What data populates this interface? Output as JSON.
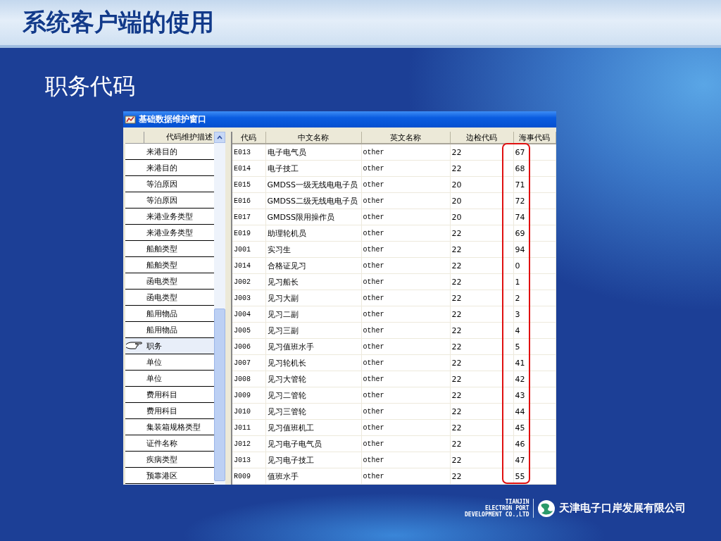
{
  "slide": {
    "title": "系统客户端的使用",
    "subtitle": "职务代码"
  },
  "window": {
    "title": "基础数据维护窗口"
  },
  "category_list": {
    "column_2": "代码维护描述",
    "items": [
      {
        "label": "来港目的",
        "selected": false
      },
      {
        "label": "来港目的",
        "selected": false
      },
      {
        "label": "等泊原因",
        "selected": false
      },
      {
        "label": "等泊原因",
        "selected": false
      },
      {
        "label": "来港业务类型",
        "selected": false
      },
      {
        "label": "来港业务类型",
        "selected": false
      },
      {
        "label": "船舶类型",
        "selected": false
      },
      {
        "label": "船舶类型",
        "selected": false
      },
      {
        "label": "函电类型",
        "selected": false
      },
      {
        "label": "函电类型",
        "selected": false
      },
      {
        "label": "船用物品",
        "selected": false
      },
      {
        "label": "船用物品",
        "selected": false
      },
      {
        "label": "职务",
        "selected": true
      },
      {
        "label": "单位",
        "selected": false
      },
      {
        "label": "单位",
        "selected": false
      },
      {
        "label": "费用科目",
        "selected": false
      },
      {
        "label": "费用科目",
        "selected": false
      },
      {
        "label": "集装箱规格类型",
        "selected": false
      },
      {
        "label": "证件名称",
        "selected": false
      },
      {
        "label": "疾病类型",
        "selected": false
      },
      {
        "label": "预靠港区",
        "selected": false
      }
    ]
  },
  "table": {
    "columns": [
      "代码",
      "中文名称",
      "英文名称",
      "边检代码",
      "海事代码"
    ],
    "rows": [
      [
        "E013",
        "电子电气员",
        "other",
        "22",
        "67"
      ],
      [
        "E014",
        "电子技工",
        "other",
        "22",
        "68"
      ],
      [
        "E015",
        "GMDSS一级无线电电子员",
        "other",
        "20",
        "71"
      ],
      [
        "E016",
        "GMDSS二级无线电电子员",
        "other",
        "20",
        "72"
      ],
      [
        "E017",
        "GMDSS限用操作员",
        "other",
        "20",
        "74"
      ],
      [
        "E019",
        "助理轮机员",
        "other",
        "22",
        "69"
      ],
      [
        "J001",
        "实习生",
        "other",
        "22",
        "94"
      ],
      [
        "J014",
        "合格证见习",
        "other",
        "22",
        "0"
      ],
      [
        "J002",
        "见习船长",
        "other",
        "22",
        "1"
      ],
      [
        "J003",
        "见习大副",
        "other",
        "22",
        "2"
      ],
      [
        "J004",
        "见习二副",
        "other",
        "22",
        "3"
      ],
      [
        "J005",
        "见习三副",
        "other",
        "22",
        "4"
      ],
      [
        "J006",
        "见习值班水手",
        "other",
        "22",
        "5"
      ],
      [
        "J007",
        "见习轮机长",
        "other",
        "22",
        "41"
      ],
      [
        "J008",
        "见习大管轮",
        "other",
        "22",
        "42"
      ],
      [
        "J009",
        "见习二管轮",
        "other",
        "22",
        "43"
      ],
      [
        "J010",
        "见习三管轮",
        "other",
        "22",
        "44"
      ],
      [
        "J011",
        "见习值班机工",
        "other",
        "22",
        "45"
      ],
      [
        "J012",
        "见习电子电气员",
        "other",
        "22",
        "46"
      ],
      [
        "J013",
        "见习电子技工",
        "other",
        "22",
        "47"
      ],
      [
        "R009",
        "值班水手",
        "other",
        "22",
        "55"
      ]
    ]
  },
  "footer": {
    "english": [
      "TIANJIN",
      "ELECTRON PORT",
      "DEVELOPMENT CO.,LTD"
    ],
    "company": "天津电子口岸发展有限公司"
  }
}
